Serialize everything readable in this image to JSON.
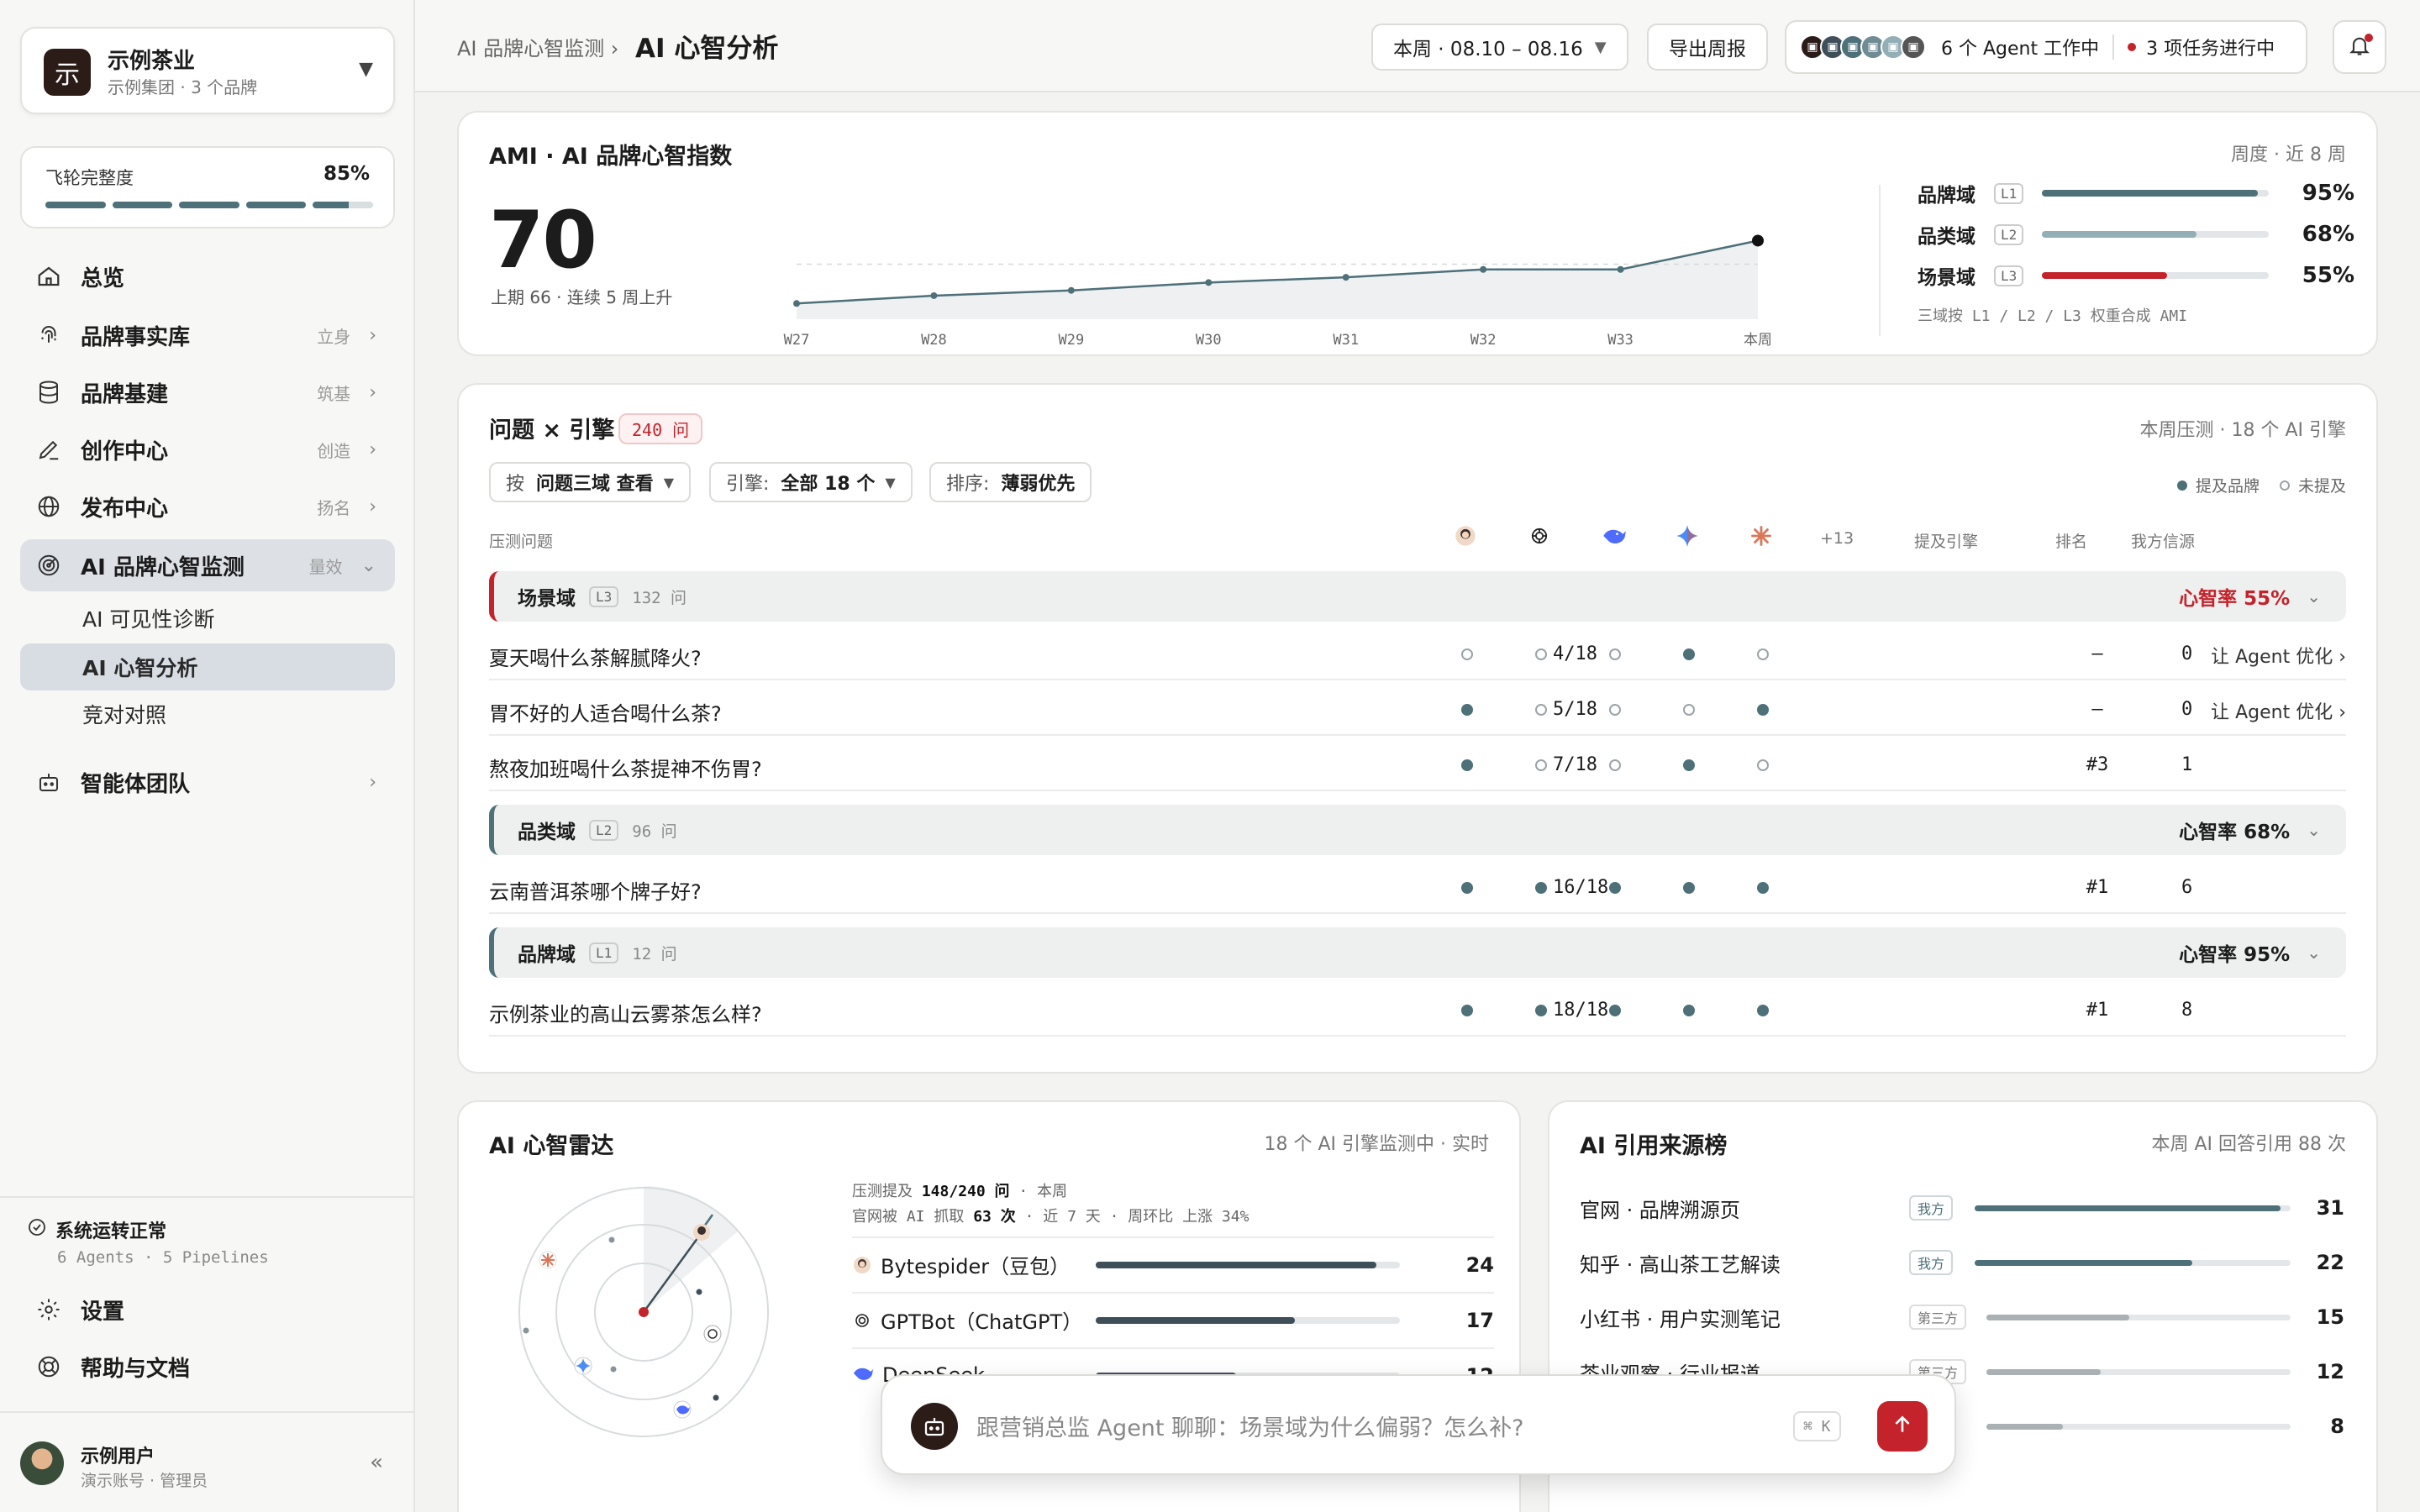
{
  "brand": {
    "logo_char": "示",
    "name": "示例茶业",
    "sub": "示例集团 · 3 个品牌"
  },
  "flywheel": {
    "label": "飞轮完整度",
    "value": "85%",
    "progress": 0.85
  },
  "nav": [
    {
      "label": "总览",
      "tag": ""
    },
    {
      "label": "品牌事实库",
      "tag": "立身"
    },
    {
      "label": "品牌基建",
      "tag": "筑基"
    },
    {
      "label": "创作中心",
      "tag": "创造"
    },
    {
      "label": "发布中心",
      "tag": "扬名"
    },
    {
      "label": "AI 品牌心智监测",
      "tag": "量效"
    },
    {
      "label": "智能体团队",
      "tag": ""
    }
  ],
  "subnav": [
    "AI 可见性诊断",
    "AI 心智分析",
    "竞对对照"
  ],
  "system": {
    "status": "系统运转正常",
    "detail": "6 Agents · 5 Pipelines"
  },
  "footer_nav": [
    "设置",
    "帮助与文档"
  ],
  "user": {
    "name": "示例用户",
    "role": "演示账号 · 管理员"
  },
  "header": {
    "breadcrumb": "AI 品牌心智监测 ›",
    "title": "AI 心智分析",
    "period": "本周 · 08.10 – 08.16",
    "export": "导出周报",
    "agents_text": "6 个 Agent 工作中",
    "tasks_text": "3 项任务进行中"
  },
  "ami": {
    "title": "AMI · AI 品牌心智指数",
    "meta": "周度 · 近 8 周",
    "value": "70",
    "sub": "上期  66  ·  连续  5  周上升",
    "note": "三域按 L1 / L2 / L3 权重合成 AMI",
    "domains": [
      {
        "name": "品牌域",
        "level": "L1",
        "pct": "95%",
        "value": 0.95,
        "color": "#4d7079"
      },
      {
        "name": "品类域",
        "level": "L2",
        "pct": "68%",
        "value": 0.68,
        "color": "#93aeb4"
      },
      {
        "name": "场景域",
        "level": "L3",
        "pct": "55%",
        "value": 0.55,
        "color": "#c4232b"
      }
    ]
  },
  "chart_data": {
    "type": "area",
    "categories": [
      "W27",
      "W28",
      "W29",
      "W30",
      "W31",
      "W32",
      "W33",
      "本周"
    ],
    "values": [
      58,
      59.5,
      60.5,
      62,
      63,
      64.5,
      64.5,
      70
    ],
    "ylim": [
      55,
      72
    ]
  },
  "questions": {
    "title": "问题 × 引擎",
    "count": "240 问",
    "meta": "本周压测 · 18 个 AI 引擎",
    "filters": [
      {
        "k": "按",
        "v": "问题三域  查看"
      },
      {
        "k": "引擎:",
        "v": "全部 18 个"
      },
      {
        "k": "排序:",
        "v": "薄弱优先"
      }
    ],
    "legend_on": "提及品牌",
    "legend_off": "未提及",
    "col_question": "压测问题",
    "col_more": "+13",
    "col_mention": "提及引擎",
    "col_rank": "排名",
    "col_source": "我方信源",
    "groups": [
      {
        "name": "场景域",
        "level": "L3",
        "count": "132 问",
        "rate": "心智率 55%",
        "red": true,
        "rows": [
          {
            "q": "夏天喝什么茶解腻降火?",
            "dots": [
              0,
              0,
              0,
              1,
              0
            ],
            "mention": "4/18",
            "rank": "–",
            "src": "0",
            "action": "让 Agent 优化 ›"
          },
          {
            "q": "胃不好的人适合喝什么茶?",
            "dots": [
              1,
              0,
              0,
              0,
              1
            ],
            "mention": "5/18",
            "rank": "–",
            "src": "0",
            "action": "让 Agent 优化 ›"
          },
          {
            "q": "熬夜加班喝什么茶提神不伤胃?",
            "dots": [
              1,
              0,
              0,
              1,
              0
            ],
            "mention": "7/18",
            "rank": "#3",
            "src": "1",
            "action": ""
          }
        ]
      },
      {
        "name": "品类域",
        "level": "L2",
        "count": "96 问",
        "rate": "心智率 68%",
        "red": false,
        "rows": [
          {
            "q": "云南普洱茶哪个牌子好?",
            "dots": [
              1,
              1,
              1,
              1,
              1
            ],
            "mention": "16/18",
            "rank": "#1",
            "src": "6",
            "action": ""
          }
        ]
      },
      {
        "name": "品牌域",
        "level": "L1",
        "count": "12 问",
        "rate": "心智率 95%",
        "red": false,
        "rows": [
          {
            "q": "示例茶业的高山云雾茶怎么样?",
            "dots": [
              1,
              1,
              1,
              1,
              1
            ],
            "mention": "18/18",
            "rank": "#1",
            "src": "8",
            "action": ""
          }
        ]
      }
    ]
  },
  "radar": {
    "title": "AI 心智雷达",
    "meta": "18 个 AI 引擎监测中 · 实时",
    "l1_pre": "压测提及",
    "l1_val": "148/240 问",
    "l1_post": "· 本周",
    "l2_pre": "官网被 AI 抓取",
    "l2_val": "63 次",
    "l2_post": "· 近 7 天 · 周环比 上涨 34%",
    "bots": [
      {
        "name": "Bytespider（豆包）",
        "value": 24
      },
      {
        "name": "GPTBot（ChatGPT）",
        "value": 17
      },
      {
        "name": "DeepSeek",
        "value": 12
      }
    ]
  },
  "sources": {
    "title": "AI 引用来源榜",
    "meta": "本周 AI 回答引用 88 次",
    "rows": [
      {
        "name": "官网 · 品牌溯源页",
        "badge": "我方",
        "value": 31
      },
      {
        "name": "知乎 · 高山茶工艺解读",
        "badge": "我方",
        "value": 22
      },
      {
        "name": "小红书 · 用户实测笔记",
        "badge": "第三方",
        "value": 15
      },
      {
        "name": "茶业观察 · 行业报道",
        "badge": "第三方",
        "value": 12
      },
      {
        "name": "",
        "badge": "方",
        "value": 8
      }
    ]
  },
  "chat": {
    "placeholder": "跟营销总监 Agent 聊聊：场景域为什么偏弱？怎么补?",
    "shortcut": "⌘ K"
  }
}
